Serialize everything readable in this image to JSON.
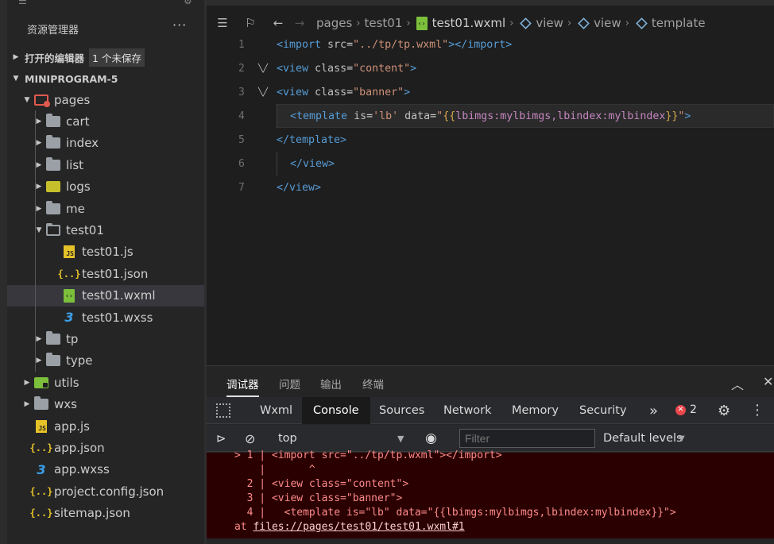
{
  "sidebar": {
    "title": "资源管理器",
    "more": "···",
    "open_editors": {
      "label": "打开的编辑器",
      "badge": "1 个未保存"
    },
    "project": {
      "label": "MINIPROGRAM-5"
    },
    "tree": [
      {
        "label": "pages",
        "type": "pages",
        "expanded": true,
        "level": 1
      },
      {
        "label": "cart",
        "type": "folder",
        "level": 2
      },
      {
        "label": "index",
        "type": "folder",
        "level": 2
      },
      {
        "label": "list",
        "type": "folder",
        "level": 2
      },
      {
        "label": "logs",
        "type": "logs",
        "level": 2
      },
      {
        "label": "me",
        "type": "folder",
        "level": 2
      },
      {
        "label": "test01",
        "type": "folder-open",
        "expanded": true,
        "level": 2
      },
      {
        "label": "test01.js",
        "type": "js",
        "level": 3
      },
      {
        "label": "test01.json",
        "type": "json",
        "level": 3
      },
      {
        "label": "test01.wxml",
        "type": "wxml",
        "level": 3,
        "selected": true
      },
      {
        "label": "test01.wxss",
        "type": "css",
        "level": 3
      },
      {
        "label": "tp",
        "type": "folder",
        "level": 2
      },
      {
        "label": "type",
        "type": "folder",
        "level": 2
      },
      {
        "label": "utils",
        "type": "utils",
        "level": 1
      },
      {
        "label": "wxs",
        "type": "folder",
        "level": 1
      },
      {
        "label": "app.js",
        "type": "js",
        "level": 1
      },
      {
        "label": "app.json",
        "type": "json",
        "level": 1
      },
      {
        "label": "app.wxss",
        "type": "css",
        "level": 1
      },
      {
        "label": "project.config.json",
        "type": "json",
        "level": 1
      },
      {
        "label": "sitemap.json",
        "type": "json",
        "level": 1
      }
    ]
  },
  "breadcrumb": {
    "items": [
      "pages",
      "test01",
      "test01.wxml",
      "view",
      "view",
      "template"
    ]
  },
  "code": {
    "lines": [
      {
        "n": "1",
        "fold": false,
        "indent": 0,
        "parts": [
          [
            "tag",
            "<import "
          ],
          [
            "attr",
            "src"
          ],
          [
            "plain",
            "="
          ],
          [
            "str",
            "\"../tp/tp.wxml\""
          ],
          [
            "tag",
            "></import>"
          ]
        ]
      },
      {
        "n": "2",
        "fold": true,
        "indent": 0,
        "parts": [
          [
            "tag",
            "<view "
          ],
          [
            "attr",
            "class"
          ],
          [
            "plain",
            "="
          ],
          [
            "str",
            "\"content\""
          ],
          [
            "tag",
            ">"
          ]
        ]
      },
      {
        "n": "3",
        "fold": true,
        "indent": 0,
        "parts": [
          [
            "tag",
            "<view "
          ],
          [
            "attr",
            "class"
          ],
          [
            "plain",
            "="
          ],
          [
            "str",
            "\"banner\""
          ],
          [
            "tag",
            ">"
          ]
        ]
      },
      {
        "n": "4",
        "fold": false,
        "indent": 1,
        "hl": true,
        "parts": [
          [
            "tag",
            "<template "
          ],
          [
            "attr",
            "is"
          ],
          [
            "plain",
            "="
          ],
          [
            "str",
            "'lb' "
          ],
          [
            "attr",
            "data"
          ],
          [
            "plain",
            "="
          ],
          [
            "str",
            "\""
          ],
          [
            "brace",
            "{{"
          ],
          [
            "exp",
            "lbimgs:mylbimgs,lbindex:mylbindex"
          ],
          [
            "brace",
            "}}"
          ],
          [
            "str",
            "\""
          ],
          [
            "tag",
            ">"
          ]
        ]
      },
      {
        "n": "5",
        "fold": false,
        "indent": 0,
        "parts": [
          [
            "tag",
            "</template>"
          ]
        ]
      },
      {
        "n": "6",
        "fold": false,
        "indent": 1,
        "parts": [
          [
            "tag",
            "</view>"
          ]
        ]
      },
      {
        "n": "7",
        "fold": false,
        "indent": 0,
        "parts": [
          [
            "tag",
            "</view>"
          ]
        ]
      }
    ]
  },
  "debugger": {
    "panel_tabs": [
      "调试器",
      "问题",
      "输出",
      "终端"
    ],
    "active_panel_tab": "调试器",
    "devtools_tabs": [
      "Wxml",
      "Console",
      "Sources",
      "Network",
      "Memory",
      "Security"
    ],
    "active_devtools_tab": "Console",
    "more_tabs": "»",
    "error_count": "2",
    "context": "top",
    "filter_placeholder": "Filter",
    "levels": "Default levels",
    "error_lines": [
      "> 1 | <import src=\"../tp/tp.wxml\"></import>",
      "    |       ^",
      "  2 | <view class=\"content\">",
      "  3 | <view class=\"banner\">",
      "  4 |   <template is=\"lb\" data=\"{{lbimgs:mylbimgs,lbindex:mylbindex}}\">"
    ],
    "at_prefix": "at ",
    "at_link": "files://pages/test01/test01.wxml#1"
  }
}
